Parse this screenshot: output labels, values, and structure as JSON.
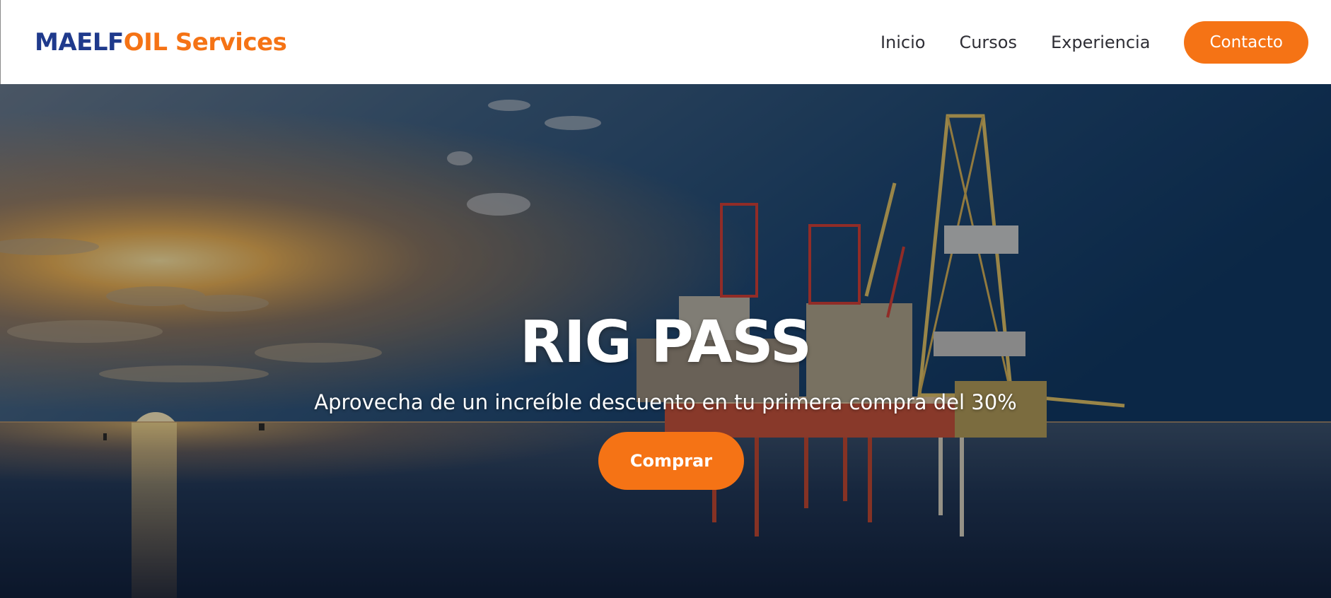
{
  "header": {
    "logo": {
      "part1": "MAELF",
      "part2": "OIL Services",
      "color_primary": "#1f3a8c",
      "color_accent": "#f57315"
    },
    "nav": {
      "items": [
        {
          "label": "Inicio"
        },
        {
          "label": "Cursos"
        },
        {
          "label": "Experiencia"
        }
      ],
      "cta_label": "Contacto"
    }
  },
  "hero": {
    "title": "RIG PASS",
    "subtitle": "Aprovecha de un increíble descuento en tu primera compra del 30%",
    "button_label": "Comprar",
    "background": "offshore-oil-rig-sunset-image"
  },
  "colors": {
    "accent": "#f57315",
    "brand_blue": "#1f3a8c",
    "nav_text": "#2e2e35"
  }
}
